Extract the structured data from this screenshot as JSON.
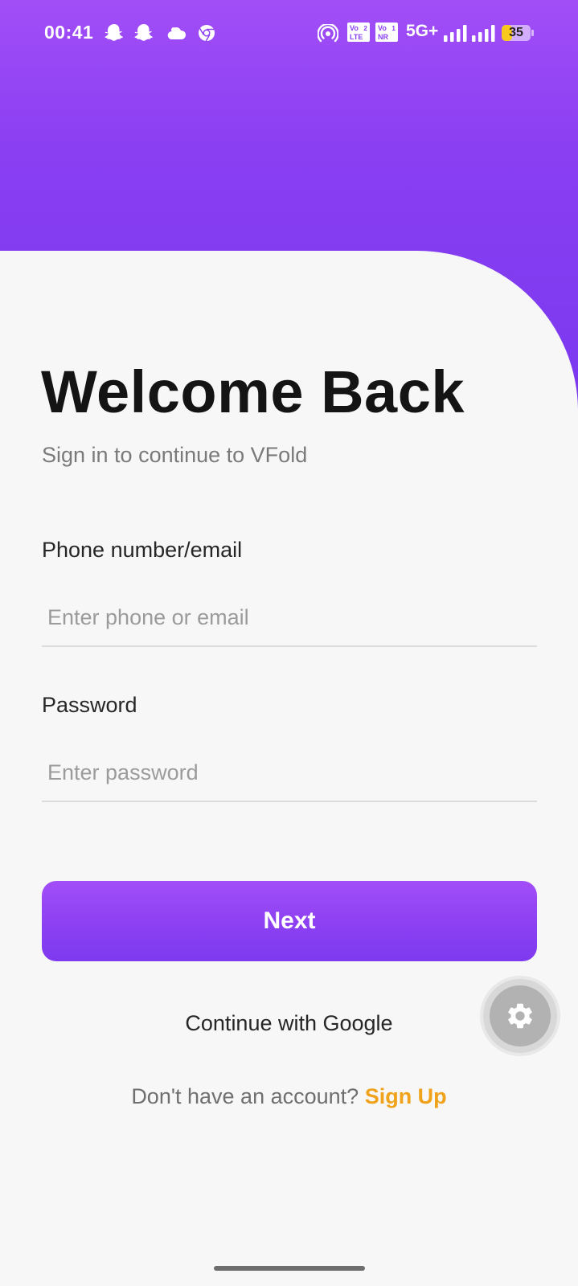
{
  "status_bar": {
    "time": "00:41",
    "network": "5G+",
    "battery_level": "35",
    "vo_badges": [
      {
        "top": "Vo",
        "bottom": "LTE",
        "sim": "2"
      },
      {
        "top": "Vo",
        "bottom": "NR",
        "sim": "1"
      }
    ],
    "icons": [
      "snapchat-icon",
      "snapchat-icon",
      "cloud-icon",
      "chrome-icon",
      "hotspot-icon",
      "signal-icon",
      "signal-icon",
      "battery-icon"
    ]
  },
  "login": {
    "title": "Welcome Back",
    "subtitle": "Sign in to continue to VFold",
    "phone_label": "Phone number/email",
    "phone_placeholder": "Enter phone or email",
    "phone_value": "",
    "password_label": "Password",
    "password_placeholder": "Enter password",
    "password_value": "",
    "next_label": "Next",
    "google_label": "Continue with Google",
    "signup_prompt": "Don't have an account?",
    "signup_label": "Sign Up"
  },
  "floating_button": {
    "icon": "gear-icon"
  },
  "colors": {
    "brand_purple": "#8a3ff2",
    "brand_purple_light": "#a24ef7",
    "accent_orange": "#f0a21a",
    "background": "#f7f7f7"
  }
}
